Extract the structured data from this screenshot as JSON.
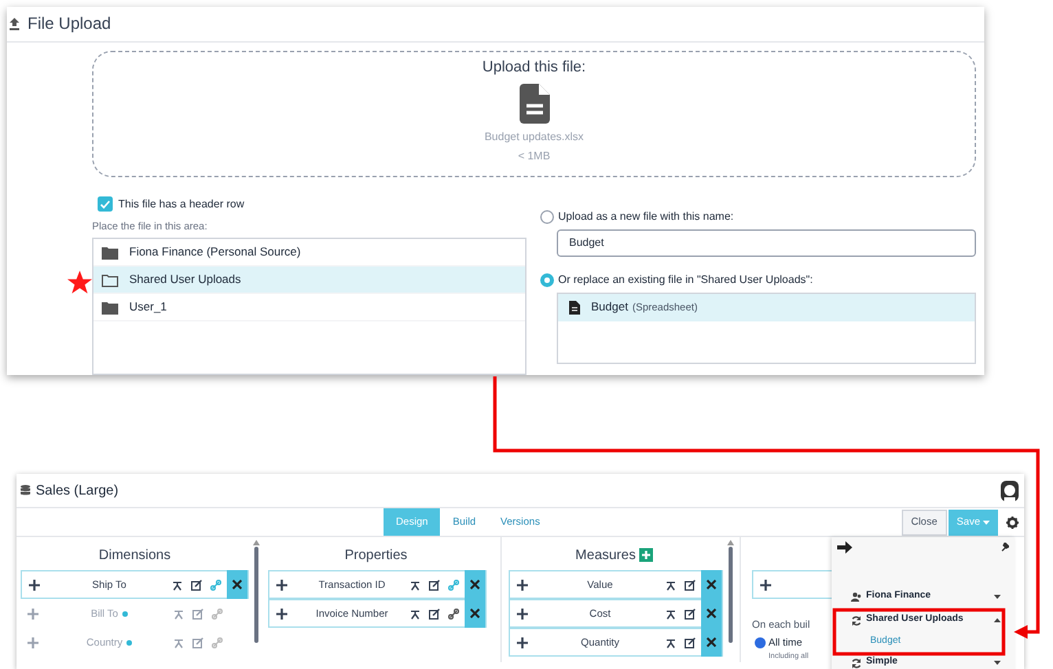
{
  "upload_panel": {
    "title": "File Upload",
    "drop_zone": {
      "heading": "Upload this file:",
      "file_name": "Budget updates.xlsx",
      "file_size": "< 1MB"
    },
    "header_row": {
      "label": "This file has a header row",
      "checked": true
    },
    "folders_label": "Place the file in this area:",
    "folders": [
      {
        "name": "Fiona Finance (Personal Source)",
        "selected": false
      },
      {
        "name": "Shared User Uploads",
        "selected": true
      },
      {
        "name": "User_1",
        "selected": false
      }
    ],
    "options": [
      {
        "label": "Upload as a new file with this name:",
        "selected": false
      },
      {
        "label": "Or replace an existing file in \"Shared User Uploads\":",
        "selected": true
      }
    ],
    "new_name": "Budget",
    "existing_files": [
      {
        "name": "Budget",
        "type": "(Spreadsheet)",
        "selected": true
      }
    ]
  },
  "model_panel": {
    "title": "Sales (Large)",
    "tabs": [
      {
        "label": "Design",
        "selected": true
      },
      {
        "label": "Build",
        "selected": false
      },
      {
        "label": "Versions",
        "selected": false
      }
    ],
    "close_button": "Close",
    "save_button": "Save",
    "columns": [
      {
        "title": "Dimensions",
        "add_button": false,
        "items": [
          {
            "name": "Ship To",
            "disabled": false,
            "dot": false,
            "linked": true
          },
          {
            "name": "Bill To",
            "disabled": true,
            "dot": true,
            "linked": false
          },
          {
            "name": "Country",
            "disabled": true,
            "dot": true,
            "linked": false
          }
        ]
      },
      {
        "title": "Properties",
        "add_button": false,
        "items": [
          {
            "name": "Transaction ID",
            "disabled": false,
            "dot": false,
            "linked": true
          },
          {
            "name": "Invoice Number",
            "disabled": false,
            "dot": false,
            "linked": false
          }
        ]
      },
      {
        "title": "Measures",
        "add_button": true,
        "items": [
          {
            "name": "Value",
            "disabled": false,
            "dot": false
          },
          {
            "name": "Cost",
            "disabled": false,
            "dot": false
          },
          {
            "name": "Quantity",
            "disabled": false,
            "dot": false
          }
        ]
      }
    ],
    "column_4": {
      "build_label": "On each buil",
      "options": [
        {
          "label": "All time",
          "selected": true
        }
      ],
      "note": "Including all"
    },
    "sources": [
      {
        "name": "Fiona Finance",
        "kind": "personal",
        "expanded": false
      },
      {
        "name": "Shared User Uploads",
        "kind": "shared",
        "expanded": true,
        "files": [
          "Budget"
        ]
      },
      {
        "name": "Simple",
        "kind": "shared",
        "expanded": false
      }
    ]
  }
}
